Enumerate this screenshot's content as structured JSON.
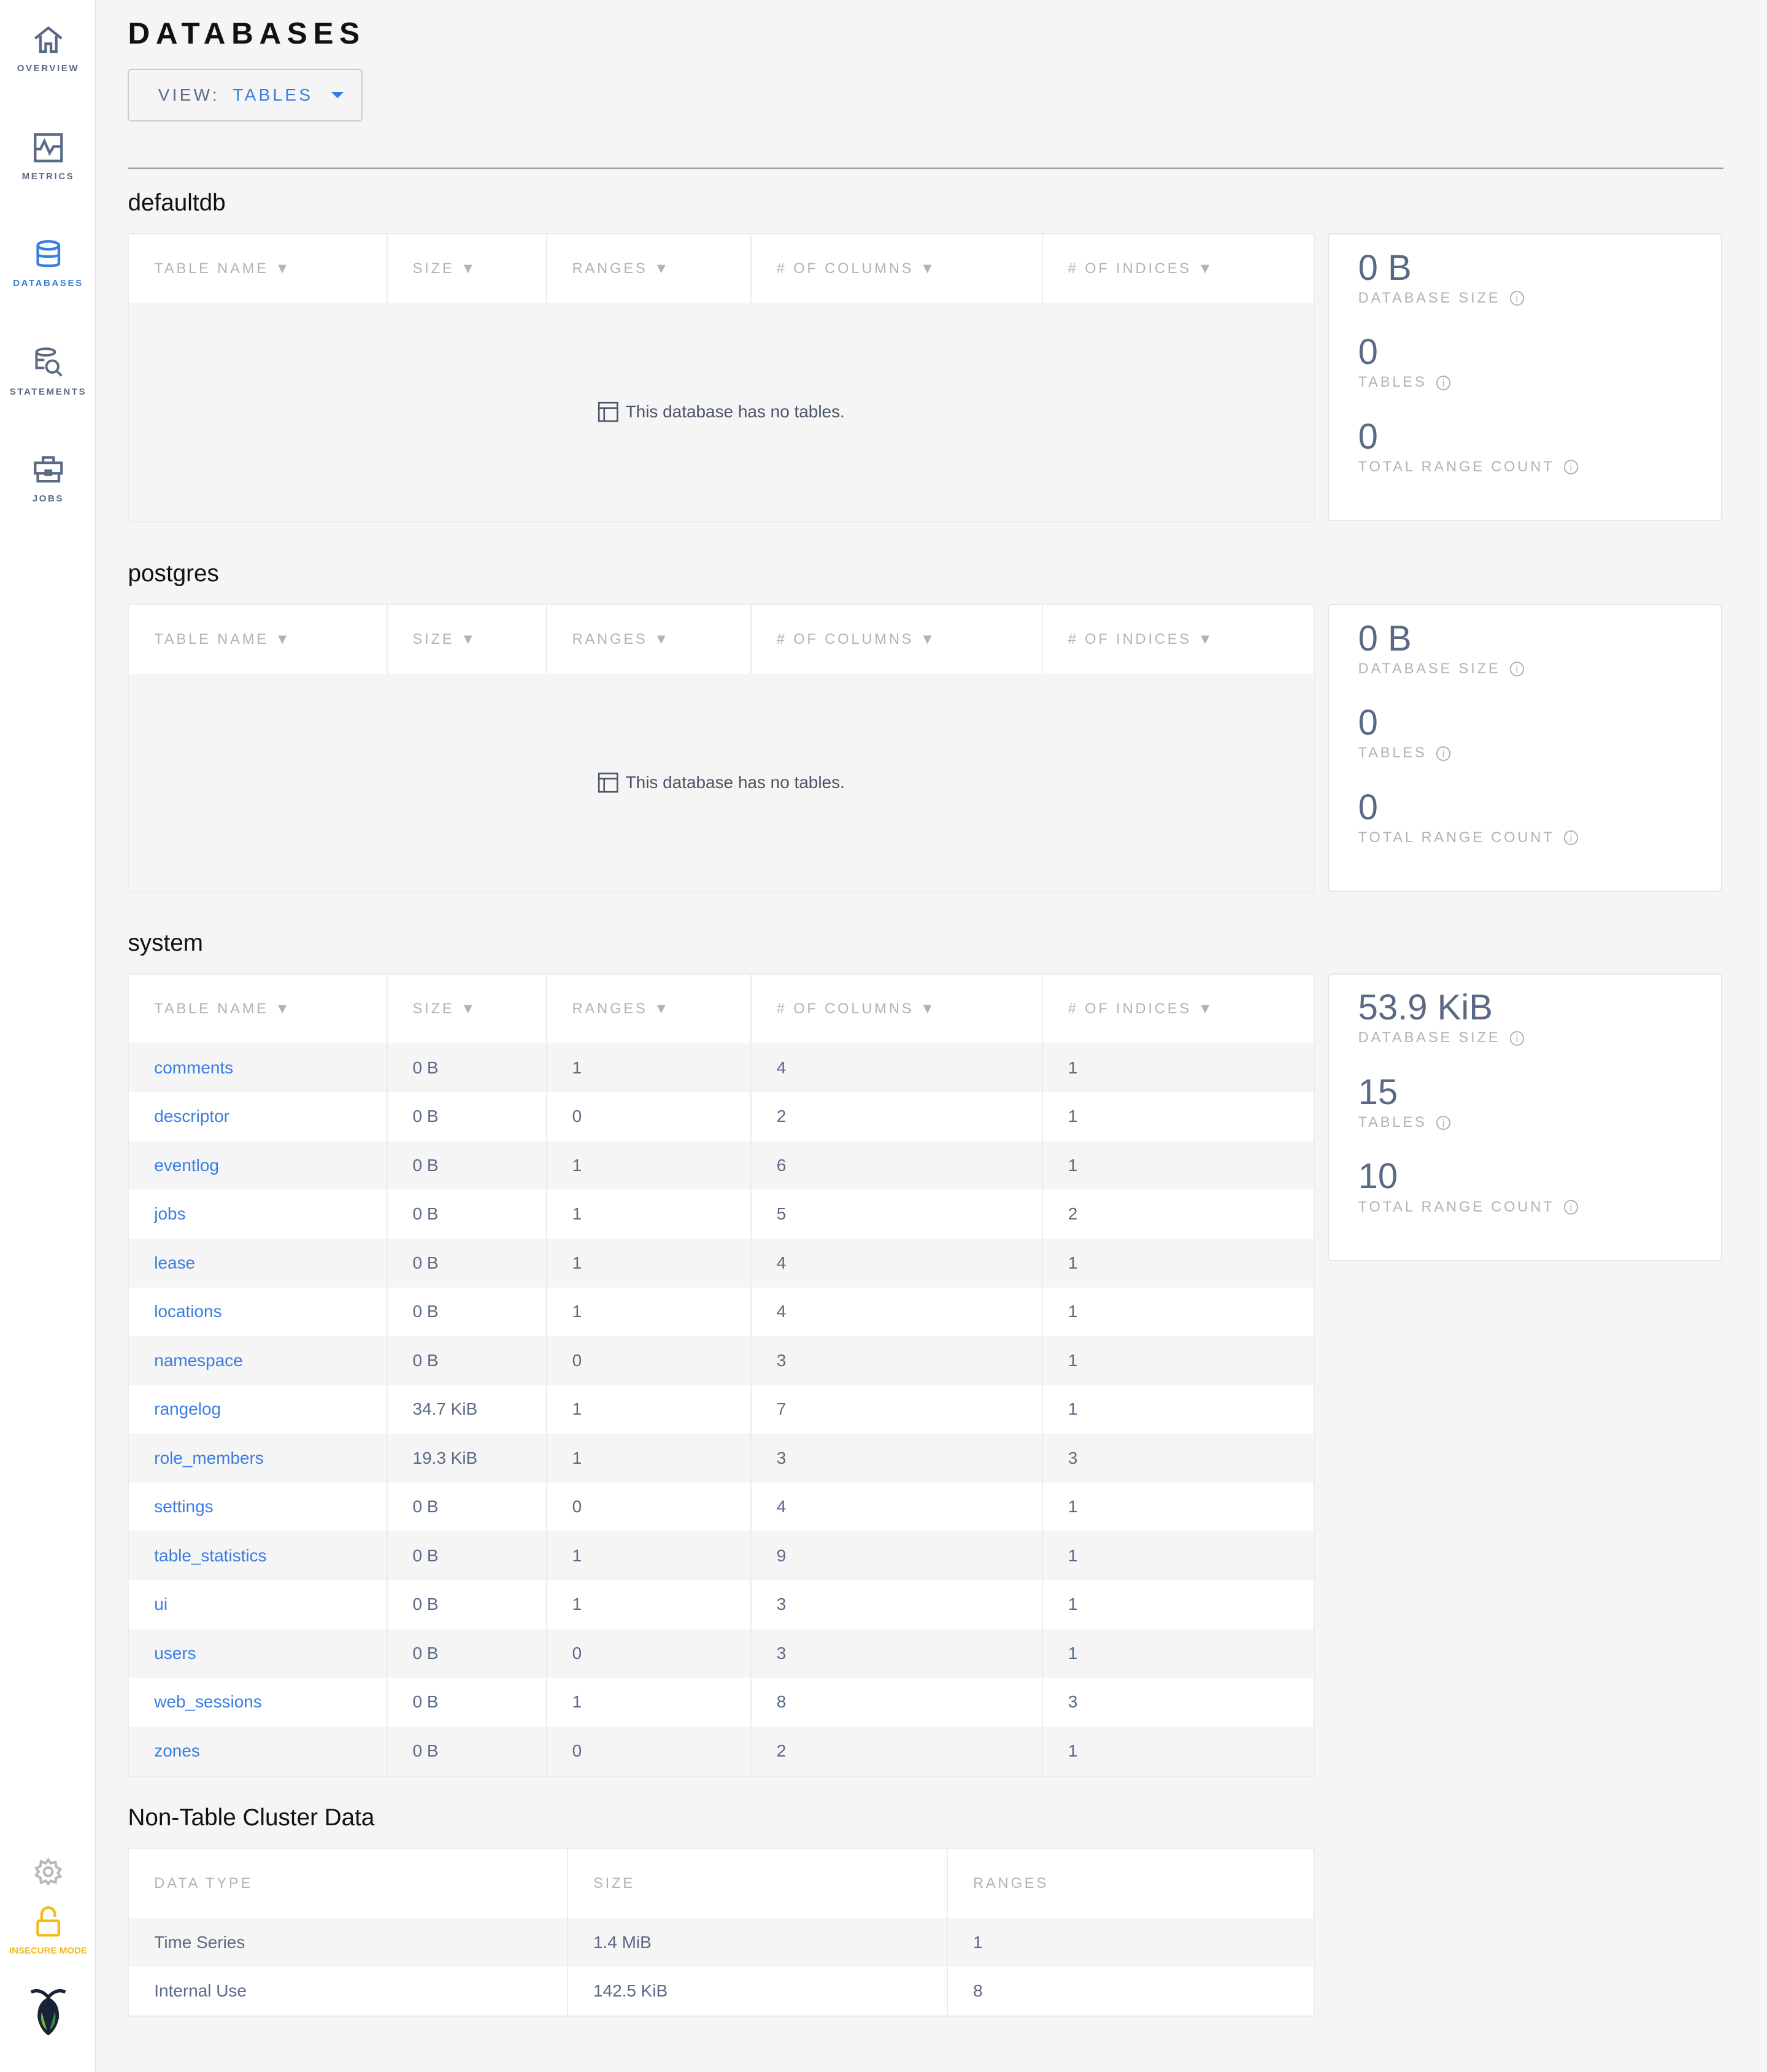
{
  "sidebar": {
    "items": [
      {
        "label": "OVERVIEW",
        "icon": "home-icon",
        "active": false
      },
      {
        "label": "METRICS",
        "icon": "metrics-icon",
        "active": false
      },
      {
        "label": "DATABASES",
        "icon": "database-icon",
        "active": true
      },
      {
        "label": "STATEMENTS",
        "icon": "statements-icon",
        "active": false
      },
      {
        "label": "JOBS",
        "icon": "briefcase-icon",
        "active": false
      }
    ],
    "settings_icon": "gear-icon",
    "insecure_label": "INSECURE MODE",
    "logo": "cockroach-logo"
  },
  "colors": {
    "accent": "#3a7de1",
    "text": "#5a6a85",
    "warning": "#f4ba1b",
    "background": "#f5f5f5"
  },
  "header": {
    "title": "DATABASES",
    "view_label": "VIEW:",
    "view_value": "TABLES"
  },
  "columns": [
    "TABLE NAME ▼",
    "SIZE ▼",
    "RANGES ▼",
    "# OF COLUMNS ▼",
    "# OF INDICES ▼"
  ],
  "empty_message": "This database has no tables.",
  "stat_labels": {
    "size": "DATABASE SIZE",
    "tables": "TABLES",
    "ranges": "TOTAL RANGE COUNT"
  },
  "databases": [
    {
      "name": "defaultdb",
      "size": "0 B",
      "tables": "0",
      "ranges": "0",
      "rows": []
    },
    {
      "name": "postgres",
      "size": "0 B",
      "tables": "0",
      "ranges": "0",
      "rows": []
    },
    {
      "name": "system",
      "size": "53.9 KiB",
      "tables": "15",
      "ranges": "10",
      "rows": [
        [
          "comments",
          "0 B",
          "1",
          "4",
          "1"
        ],
        [
          "descriptor",
          "0 B",
          "0",
          "2",
          "1"
        ],
        [
          "eventlog",
          "0 B",
          "1",
          "6",
          "1"
        ],
        [
          "jobs",
          "0 B",
          "1",
          "5",
          "2"
        ],
        [
          "lease",
          "0 B",
          "1",
          "4",
          "1"
        ],
        [
          "locations",
          "0 B",
          "1",
          "4",
          "1"
        ],
        [
          "namespace",
          "0 B",
          "0",
          "3",
          "1"
        ],
        [
          "rangelog",
          "34.7 KiB",
          "1",
          "7",
          "1"
        ],
        [
          "role_members",
          "19.3 KiB",
          "1",
          "3",
          "3"
        ],
        [
          "settings",
          "0 B",
          "0",
          "4",
          "1"
        ],
        [
          "table_statistics",
          "0 B",
          "1",
          "9",
          "1"
        ],
        [
          "ui",
          "0 B",
          "1",
          "3",
          "1"
        ],
        [
          "users",
          "0 B",
          "0",
          "3",
          "1"
        ],
        [
          "web_sessions",
          "0 B",
          "1",
          "8",
          "3"
        ],
        [
          "zones",
          "0 B",
          "0",
          "2",
          "1"
        ]
      ]
    }
  ],
  "non_table": {
    "title": "Non-Table Cluster Data",
    "columns": [
      "DATA TYPE",
      "SIZE",
      "RANGES"
    ],
    "rows": [
      [
        "Time Series",
        "1.4 MiB",
        "1"
      ],
      [
        "Internal Use",
        "142.5 KiB",
        "8"
      ]
    ]
  }
}
